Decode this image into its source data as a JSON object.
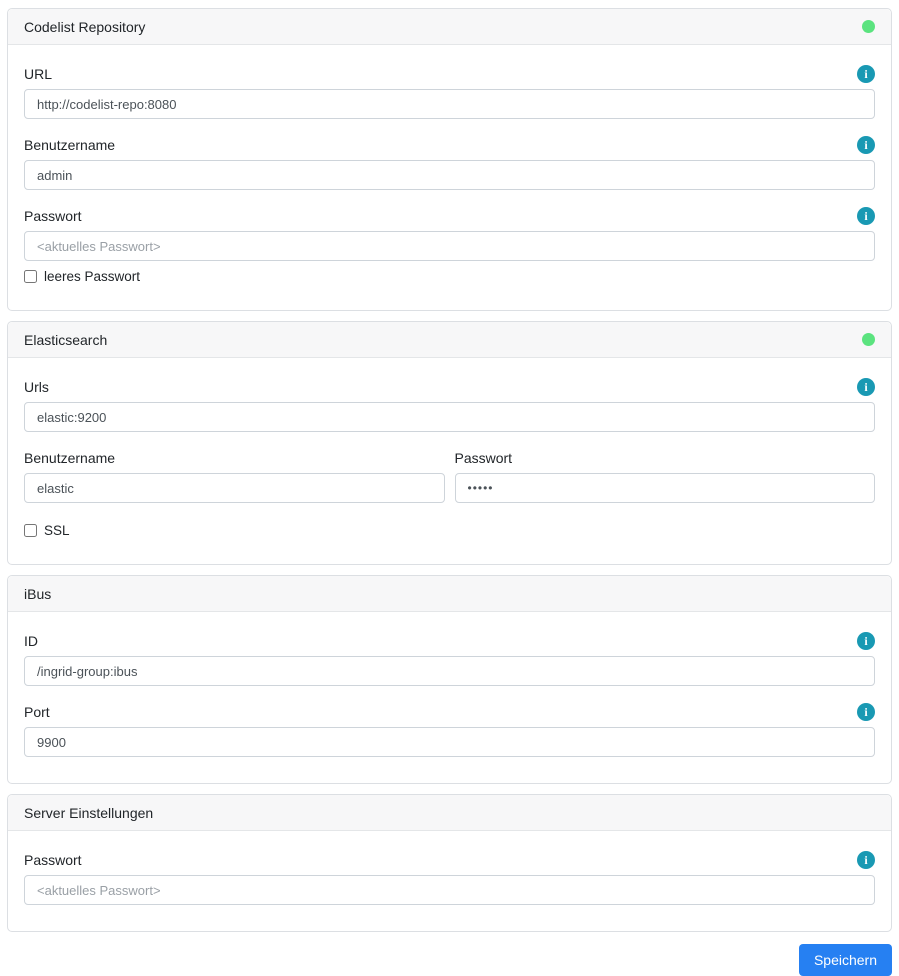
{
  "colors": {
    "status_ok_green": "#5be37f",
    "info_icon_teal": "#1999b3",
    "primary_button_blue": "#2680f2",
    "card_header_bg": "#f7f7f8"
  },
  "icons": {
    "info_glyph": "i"
  },
  "cards": {
    "codelist_repository": {
      "title": "Codelist Repository",
      "status": "ok",
      "url": {
        "label": "URL",
        "value": "http://codelist-repo:8080"
      },
      "username": {
        "label": "Benutzername",
        "value": "admin"
      },
      "password": {
        "label": "Passwort",
        "value": "",
        "placeholder": "<aktuelles Passwort>"
      },
      "empty_password_checkbox": {
        "label": "leeres Passwort",
        "checked": false
      }
    },
    "elasticsearch": {
      "title": "Elasticsearch",
      "status": "ok",
      "urls": {
        "label": "Urls",
        "value": "elastic:9200"
      },
      "username": {
        "label": "Benutzername",
        "value": "elastic"
      },
      "password": {
        "label": "Passwort",
        "masked_value": "•••••"
      },
      "ssl_checkbox": {
        "label": "SSL",
        "checked": false
      }
    },
    "ibus": {
      "title": "iBus",
      "id": {
        "label": "ID",
        "value": "/ingrid-group:ibus"
      },
      "port": {
        "label": "Port",
        "value": "9900"
      }
    },
    "server_einstellungen": {
      "title": "Server Einstellungen",
      "password": {
        "label": "Passwort",
        "value": "",
        "placeholder": "<aktuelles Passwort>"
      }
    }
  },
  "footer": {
    "save_label": "Speichern"
  }
}
